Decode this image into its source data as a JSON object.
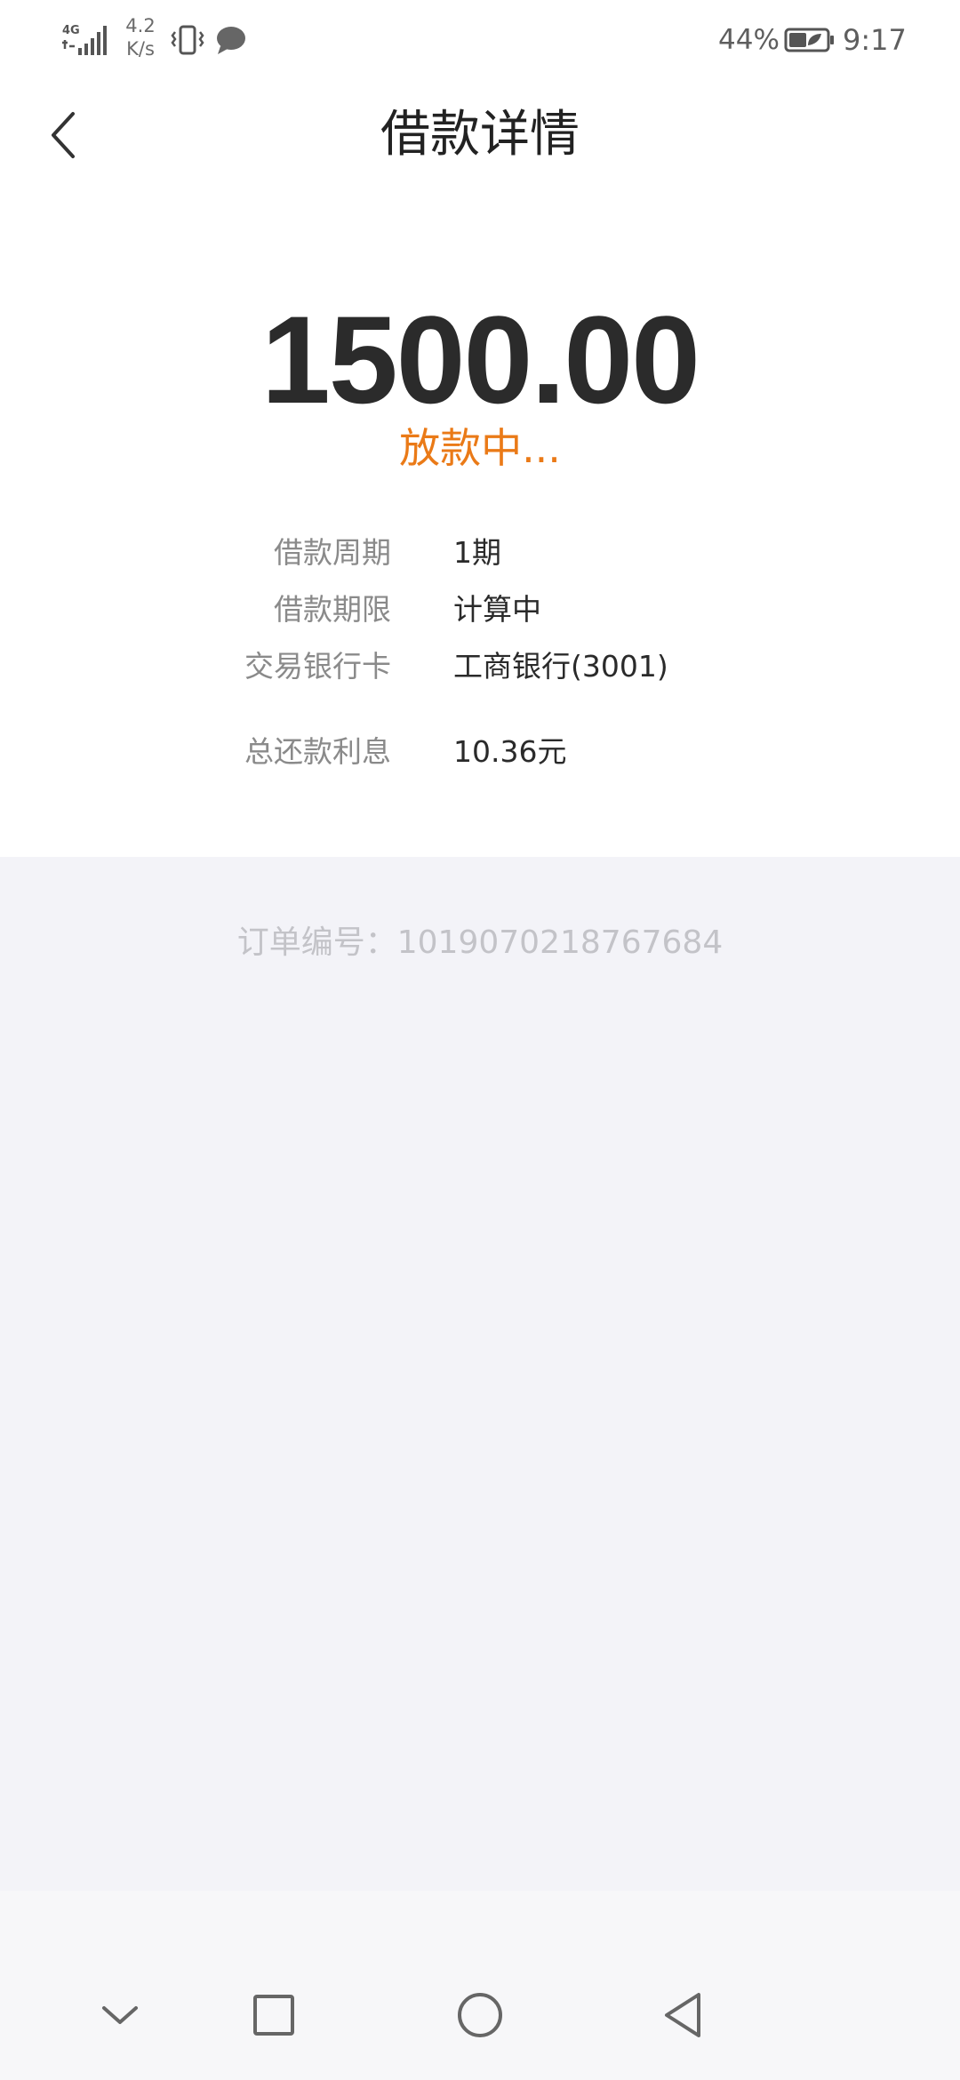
{
  "status_bar": {
    "network": "4G",
    "speed_value": "4.2",
    "speed_unit": "K/s",
    "battery_percent": "44%",
    "time": "9:17",
    "icons": [
      "signal-icon",
      "vibrate-icon",
      "chat-bubble-icon",
      "battery-icon"
    ]
  },
  "header": {
    "title": "借款详情",
    "back_icon": "chevron-left-icon"
  },
  "loan": {
    "amount": "1500.00",
    "status": "放款中...",
    "status_color": "#ea7a17",
    "details": [
      {
        "label": "借款周期",
        "value": "1期"
      },
      {
        "label": "借款期限",
        "value": "计算中"
      },
      {
        "label": "交易银行卡",
        "value": "工商银行(3001)"
      },
      {
        "label": "总还款利息",
        "value": "10.36元"
      }
    ]
  },
  "order": {
    "text": "订单编号：1019070218767684"
  },
  "nav": {
    "buttons": [
      "chevron-down-icon",
      "square-icon",
      "circle-icon",
      "triangle-back-icon"
    ]
  },
  "colors": {
    "page_background": "#f3f3f8",
    "card_background": "#ffffff",
    "accent": "#ea7a17"
  }
}
